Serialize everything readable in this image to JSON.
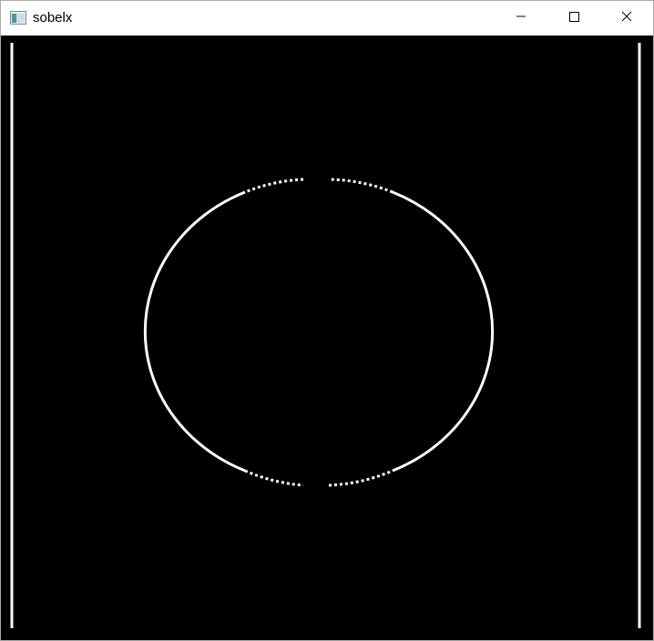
{
  "window": {
    "title": "sobelx",
    "app_icon": "opencv-window-icon",
    "controls": {
      "minimize_icon": "minimize-icon",
      "maximize_icon": "maximize-icon",
      "close_icon": "close-icon"
    }
  },
  "image": {
    "description_colors": {
      "background": "#000000",
      "edges": "#ffffff"
    }
  }
}
